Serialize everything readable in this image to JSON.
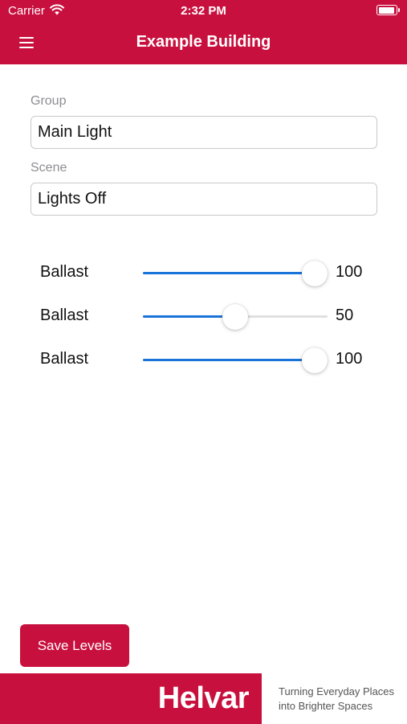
{
  "status_bar": {
    "carrier": "Carrier",
    "time": "2:32 PM",
    "icons": [
      "wifi-icon",
      "battery-icon"
    ]
  },
  "nav": {
    "title": "Example Building",
    "menu_icon": "hamburger-menu-icon"
  },
  "form": {
    "group_label": "Group",
    "group_value": "Main Light",
    "scene_label": "Scene",
    "scene_value": "Lights Off"
  },
  "ballasts": [
    {
      "label": "Ballast",
      "value": "100",
      "level": 100
    },
    {
      "label": "Ballast",
      "value": "50",
      "level": 50
    },
    {
      "label": "Ballast",
      "value": "100",
      "level": 100
    }
  ],
  "slider_max": 100,
  "save_button": {
    "label": "Save Levels"
  },
  "footer": {
    "logo": "Helvar",
    "tagline_line1": "Turning Everyday Places",
    "tagline_line2": "into Brighter Spaces"
  },
  "colors": {
    "brand": "#c8103e",
    "slider_fill": "#1a73d9",
    "slider_track": "#e0e0e0"
  }
}
